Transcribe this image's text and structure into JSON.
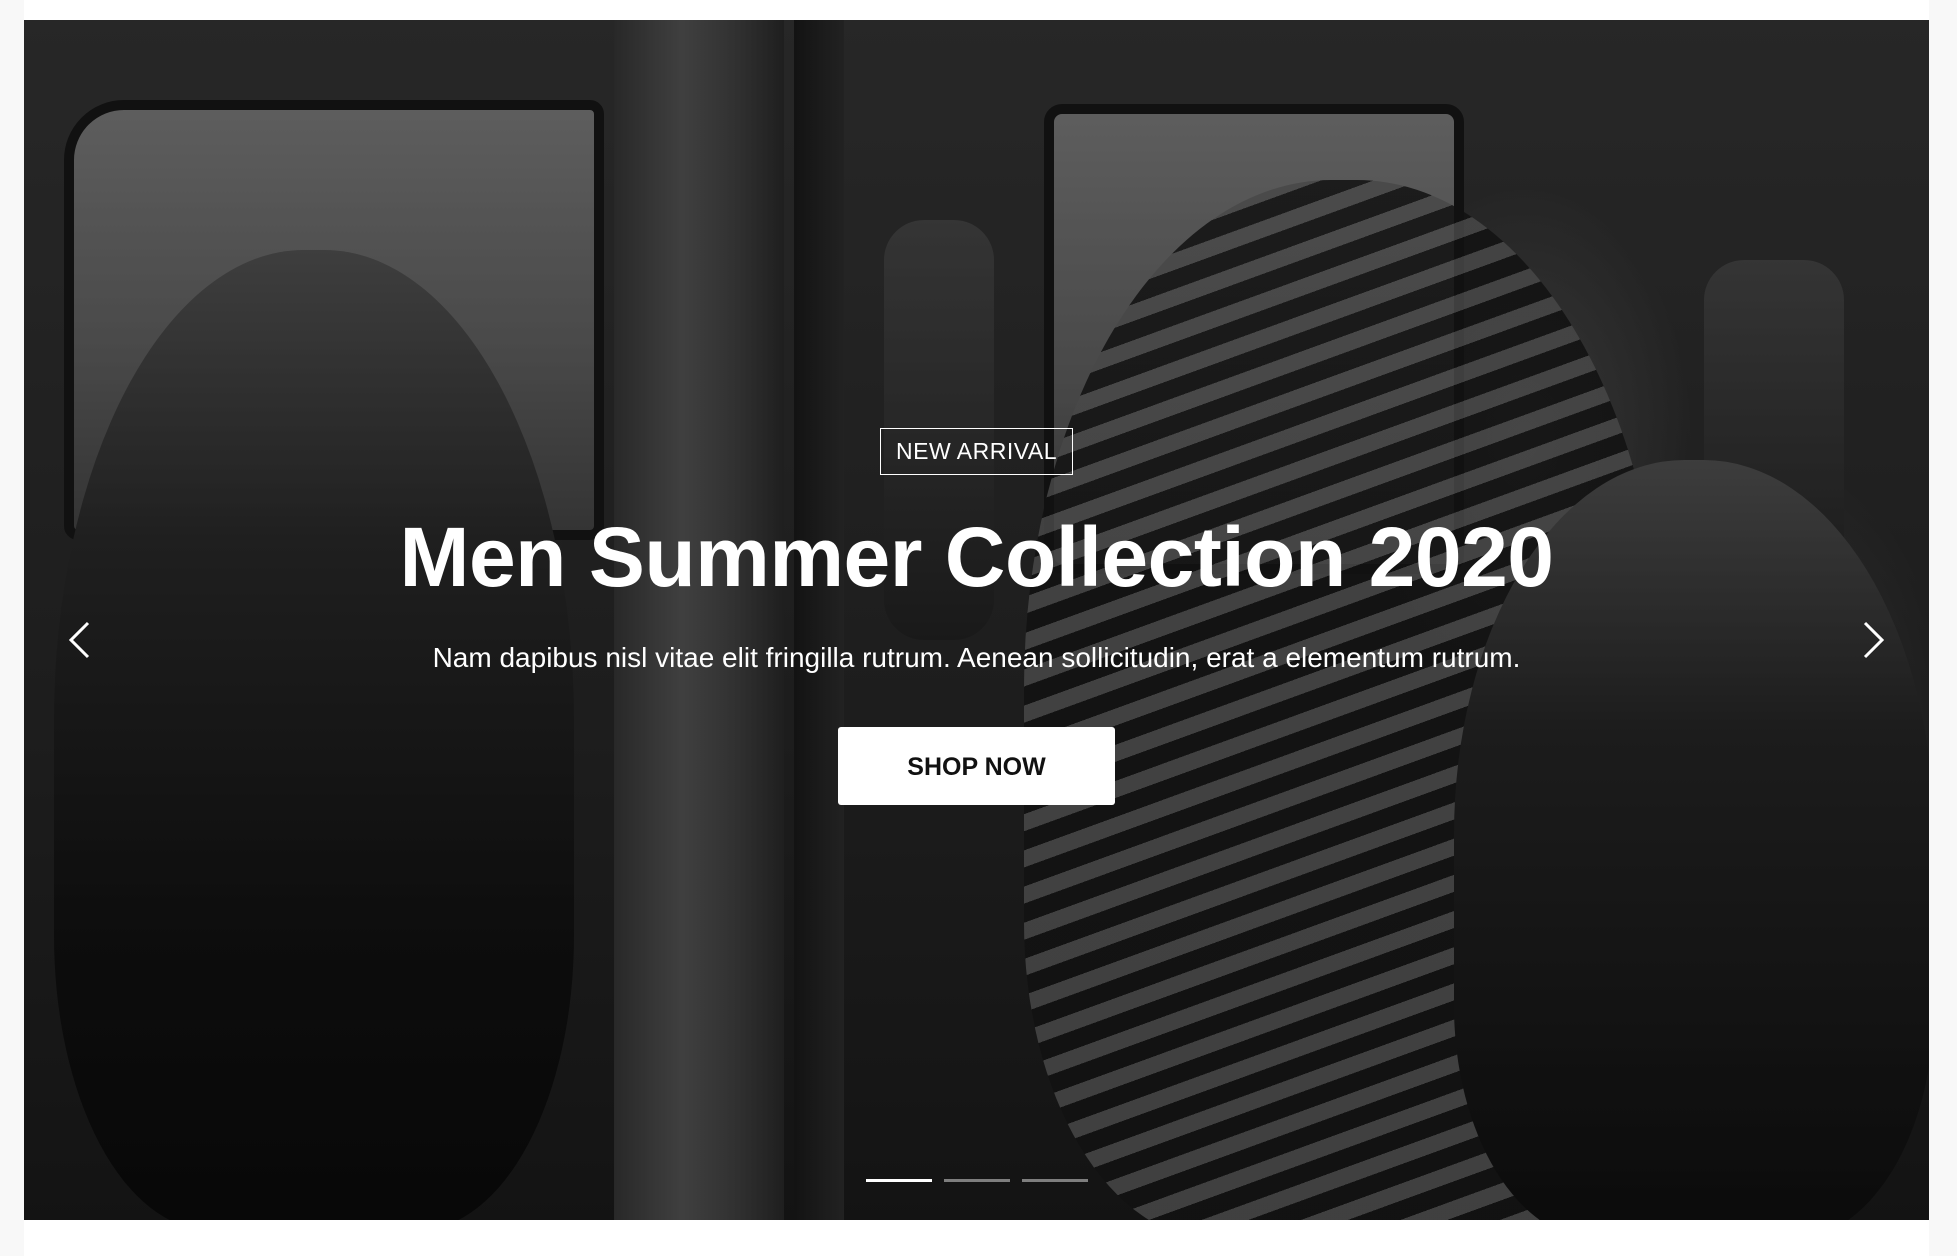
{
  "hero": {
    "badge": "NEW ARRIVAL",
    "headline": "Men Summer Collection 2020",
    "subtitle": "Nam dapibus nisl vitae elit fringilla rutrum. Aenean sollicitudin, erat a elementum rutrum.",
    "cta_label": "SHOP NOW",
    "prev_icon": "chevron-left-icon",
    "next_icon": "chevron-right-icon",
    "slides_total": 3,
    "active_slide": 1,
    "background_image": "monochrome photo of three men in a van",
    "text_color": "#ffffff",
    "button_bg": "#ffffff",
    "button_text_color": "#111111"
  }
}
